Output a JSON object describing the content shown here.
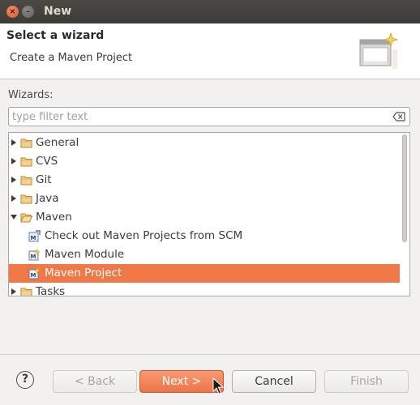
{
  "window": {
    "title": "New"
  },
  "header": {
    "title": "Select a wizard",
    "description": "Create a Maven Project"
  },
  "wizards_label": "Wizards:",
  "filter": {
    "placeholder": "type filter text",
    "value": ""
  },
  "tree": {
    "items": [
      {
        "label": "General",
        "type": "folder",
        "expanded": false
      },
      {
        "label": "CVS",
        "type": "folder",
        "expanded": false
      },
      {
        "label": "Git",
        "type": "folder",
        "expanded": false
      },
      {
        "label": "Java",
        "type": "folder",
        "expanded": false
      },
      {
        "label": "Maven",
        "type": "folder",
        "expanded": true
      },
      {
        "label": "Check out Maven Projects from SCM",
        "type": "maven-item"
      },
      {
        "label": "Maven Module",
        "type": "maven-item"
      },
      {
        "label": "Maven Project",
        "type": "maven-item",
        "selected": true
      },
      {
        "label": "Tasks",
        "type": "folder",
        "expanded": false
      }
    ]
  },
  "buttons": {
    "back": "< Back",
    "next": "Next >",
    "cancel": "Cancel",
    "finish": "Finish"
  },
  "colors": {
    "selection": "#f07746",
    "primary_button": "#ef7447"
  }
}
